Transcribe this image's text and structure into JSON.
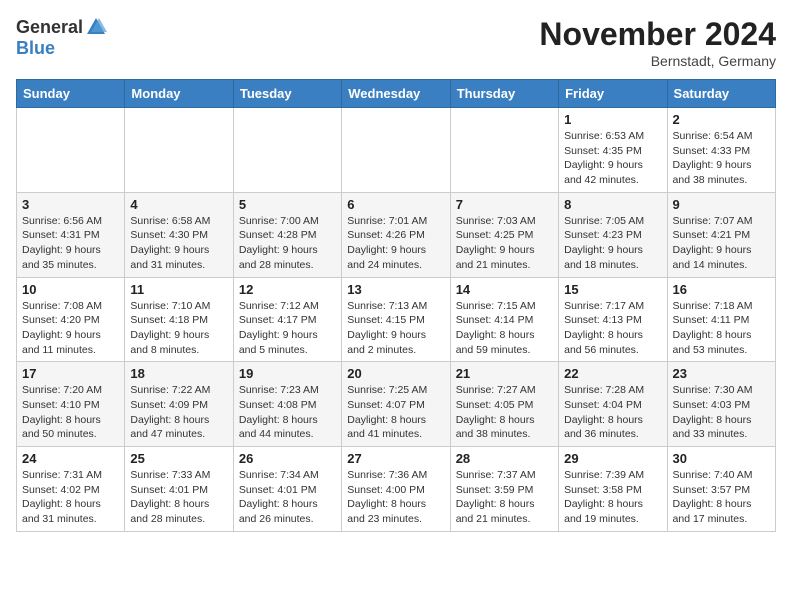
{
  "header": {
    "logo_general": "General",
    "logo_blue": "Blue",
    "month_title": "November 2024",
    "location": "Bernstadt, Germany"
  },
  "days_of_week": [
    "Sunday",
    "Monday",
    "Tuesday",
    "Wednesday",
    "Thursday",
    "Friday",
    "Saturday"
  ],
  "weeks": [
    [
      {
        "day": "",
        "info": ""
      },
      {
        "day": "",
        "info": ""
      },
      {
        "day": "",
        "info": ""
      },
      {
        "day": "",
        "info": ""
      },
      {
        "day": "",
        "info": ""
      },
      {
        "day": "1",
        "info": "Sunrise: 6:53 AM\nSunset: 4:35 PM\nDaylight: 9 hours and 42 minutes."
      },
      {
        "day": "2",
        "info": "Sunrise: 6:54 AM\nSunset: 4:33 PM\nDaylight: 9 hours and 38 minutes."
      }
    ],
    [
      {
        "day": "3",
        "info": "Sunrise: 6:56 AM\nSunset: 4:31 PM\nDaylight: 9 hours and 35 minutes."
      },
      {
        "day": "4",
        "info": "Sunrise: 6:58 AM\nSunset: 4:30 PM\nDaylight: 9 hours and 31 minutes."
      },
      {
        "day": "5",
        "info": "Sunrise: 7:00 AM\nSunset: 4:28 PM\nDaylight: 9 hours and 28 minutes."
      },
      {
        "day": "6",
        "info": "Sunrise: 7:01 AM\nSunset: 4:26 PM\nDaylight: 9 hours and 24 minutes."
      },
      {
        "day": "7",
        "info": "Sunrise: 7:03 AM\nSunset: 4:25 PM\nDaylight: 9 hours and 21 minutes."
      },
      {
        "day": "8",
        "info": "Sunrise: 7:05 AM\nSunset: 4:23 PM\nDaylight: 9 hours and 18 minutes."
      },
      {
        "day": "9",
        "info": "Sunrise: 7:07 AM\nSunset: 4:21 PM\nDaylight: 9 hours and 14 minutes."
      }
    ],
    [
      {
        "day": "10",
        "info": "Sunrise: 7:08 AM\nSunset: 4:20 PM\nDaylight: 9 hours and 11 minutes."
      },
      {
        "day": "11",
        "info": "Sunrise: 7:10 AM\nSunset: 4:18 PM\nDaylight: 9 hours and 8 minutes."
      },
      {
        "day": "12",
        "info": "Sunrise: 7:12 AM\nSunset: 4:17 PM\nDaylight: 9 hours and 5 minutes."
      },
      {
        "day": "13",
        "info": "Sunrise: 7:13 AM\nSunset: 4:15 PM\nDaylight: 9 hours and 2 minutes."
      },
      {
        "day": "14",
        "info": "Sunrise: 7:15 AM\nSunset: 4:14 PM\nDaylight: 8 hours and 59 minutes."
      },
      {
        "day": "15",
        "info": "Sunrise: 7:17 AM\nSunset: 4:13 PM\nDaylight: 8 hours and 56 minutes."
      },
      {
        "day": "16",
        "info": "Sunrise: 7:18 AM\nSunset: 4:11 PM\nDaylight: 8 hours and 53 minutes."
      }
    ],
    [
      {
        "day": "17",
        "info": "Sunrise: 7:20 AM\nSunset: 4:10 PM\nDaylight: 8 hours and 50 minutes."
      },
      {
        "day": "18",
        "info": "Sunrise: 7:22 AM\nSunset: 4:09 PM\nDaylight: 8 hours and 47 minutes."
      },
      {
        "day": "19",
        "info": "Sunrise: 7:23 AM\nSunset: 4:08 PM\nDaylight: 8 hours and 44 minutes."
      },
      {
        "day": "20",
        "info": "Sunrise: 7:25 AM\nSunset: 4:07 PM\nDaylight: 8 hours and 41 minutes."
      },
      {
        "day": "21",
        "info": "Sunrise: 7:27 AM\nSunset: 4:05 PM\nDaylight: 8 hours and 38 minutes."
      },
      {
        "day": "22",
        "info": "Sunrise: 7:28 AM\nSunset: 4:04 PM\nDaylight: 8 hours and 36 minutes."
      },
      {
        "day": "23",
        "info": "Sunrise: 7:30 AM\nSunset: 4:03 PM\nDaylight: 8 hours and 33 minutes."
      }
    ],
    [
      {
        "day": "24",
        "info": "Sunrise: 7:31 AM\nSunset: 4:02 PM\nDaylight: 8 hours and 31 minutes."
      },
      {
        "day": "25",
        "info": "Sunrise: 7:33 AM\nSunset: 4:01 PM\nDaylight: 8 hours and 28 minutes."
      },
      {
        "day": "26",
        "info": "Sunrise: 7:34 AM\nSunset: 4:01 PM\nDaylight: 8 hours and 26 minutes."
      },
      {
        "day": "27",
        "info": "Sunrise: 7:36 AM\nSunset: 4:00 PM\nDaylight: 8 hours and 23 minutes."
      },
      {
        "day": "28",
        "info": "Sunrise: 7:37 AM\nSunset: 3:59 PM\nDaylight: 8 hours and 21 minutes."
      },
      {
        "day": "29",
        "info": "Sunrise: 7:39 AM\nSunset: 3:58 PM\nDaylight: 8 hours and 19 minutes."
      },
      {
        "day": "30",
        "info": "Sunrise: 7:40 AM\nSunset: 3:57 PM\nDaylight: 8 hours and 17 minutes."
      }
    ]
  ]
}
